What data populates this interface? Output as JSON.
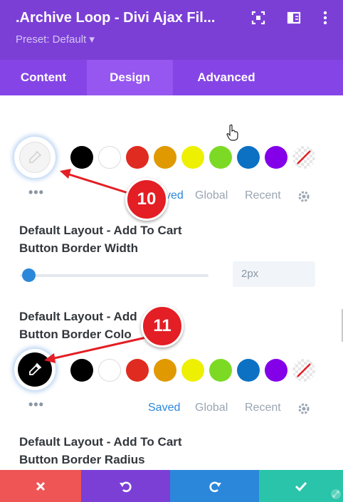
{
  "header": {
    "title": ".Archive Loop - Divi Ajax Fil...",
    "preset": "Preset: Default ▾",
    "bg": "#7b3fd6"
  },
  "tabs": [
    {
      "label": "Content",
      "active": false
    },
    {
      "label": "Design",
      "active": true
    },
    {
      "label": "Advanced",
      "active": false
    }
  ],
  "palette": [
    "#000000",
    "#ffffff",
    "#e02b20",
    "#e09900",
    "#edf000",
    "#7cda24",
    "#0c71c3",
    "#8300e9",
    "transparent"
  ],
  "color_section_1": {
    "tabs": [
      "Saved",
      "Global",
      "Recent"
    ],
    "saved_partial": "ved",
    "active_tab": "Saved"
  },
  "border_width": {
    "label_line1": "Default Layout - Add To Cart",
    "label_line2": "Button Border Width",
    "value": "2px",
    "slider_fraction": 0.04
  },
  "border_color": {
    "label_line1_visible": "Default Layout - Add",
    "label_line1_end": "rt",
    "label_line2_visible": "Button Border Colo",
    "tabs": [
      "Saved",
      "Global",
      "Recent"
    ],
    "active_tab": "Saved",
    "selected_color": "#000000"
  },
  "border_radius": {
    "label_line1": "Default Layout - Add To Cart",
    "label_line2": "Button Border Radius"
  },
  "annotations": {
    "badge_10": "10",
    "badge_11": "11",
    "color": "#e31e24"
  },
  "footer": {
    "cancel_color": "#ef5555",
    "undo_color": "#7b3fd6",
    "redo_color": "#2b87da",
    "save_color": "#29c4a9"
  }
}
